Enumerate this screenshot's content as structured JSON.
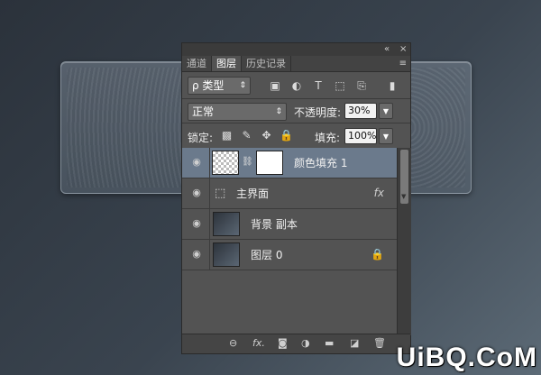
{
  "panel": {
    "titlebar": {
      "collapse_icon": "«",
      "close_icon": "×"
    },
    "tabs": [
      {
        "label": "通道",
        "active": false
      },
      {
        "label": "图层",
        "active": true
      },
      {
        "label": "历史记录",
        "active": false
      }
    ],
    "menu_icon": "≡",
    "filter": {
      "kind_label": "ρ 类型",
      "icons": [
        "image-filter-icon",
        "adjustment-filter-icon",
        "type-filter-icon",
        "shape-filter-icon",
        "smart-object-filter-icon",
        "toggle-filter-icon"
      ],
      "icon_glyphs": [
        "▣",
        "◐",
        "T",
        "⬚",
        "⎘",
        "▮"
      ]
    },
    "blend": {
      "mode": "正常",
      "opacity_label": "不透明度:",
      "opacity_value": "30%"
    },
    "lock": {
      "label": "锁定:",
      "fill_label": "填充:",
      "fill_value": "100%"
    },
    "layers": [
      {
        "name": "颜色填充 1",
        "selected": true
      },
      {
        "name": "主界面",
        "selected": false,
        "fx": "fx"
      },
      {
        "name": "背景 副本",
        "selected": false
      },
      {
        "name": "图层 0",
        "selected": false,
        "locked": true
      }
    ],
    "bottom_icons": [
      "link-icon",
      "fx-icon",
      "mask-icon",
      "adjustment-icon",
      "folder-icon",
      "new-layer-icon",
      "trash-icon"
    ],
    "bottom_glyphs": [
      "⊖",
      "fx.",
      "◙",
      "◑",
      "▬",
      "◪",
      "🗑"
    ]
  },
  "watermark": "UiBQ.CoM"
}
